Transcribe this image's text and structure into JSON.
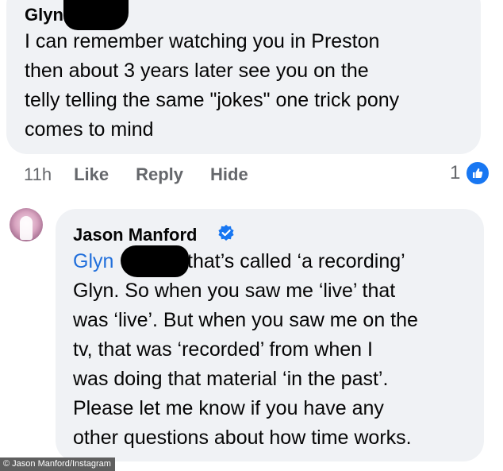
{
  "comment1": {
    "author": "Glyn",
    "lines": [
      "I can remember watching you in Preston",
      "then about 3 years later see you on the",
      "telly telling the same \"jokes\" one trick pony",
      "comes to mind"
    ],
    "time": "11h",
    "actions": {
      "like": "Like",
      "reply": "Reply",
      "hide": "Hide"
    },
    "reaction_count": "1"
  },
  "comment2": {
    "author": "Jason Manford",
    "mention": "Glyn",
    "lines": [
      "that’s called ‘a recording’",
      "Glyn. So when you saw me ‘live’ that",
      "was ‘live’. But when you saw me on the",
      "tv, that was ‘recorded’ from when I",
      "was doing that material ‘in the past’.",
      "Please let me know if you have any",
      "other questions about how time works."
    ]
  },
  "credit": "© Jason Manford/Instagram",
  "colors": {
    "bubble": "#f0f2f5",
    "secondary_text": "#65676b",
    "mention": "#216fdb",
    "like_blue": "#1877f2"
  },
  "icons": {
    "reaction": "thumbs-up-icon",
    "verified": "verified-badge-icon"
  }
}
